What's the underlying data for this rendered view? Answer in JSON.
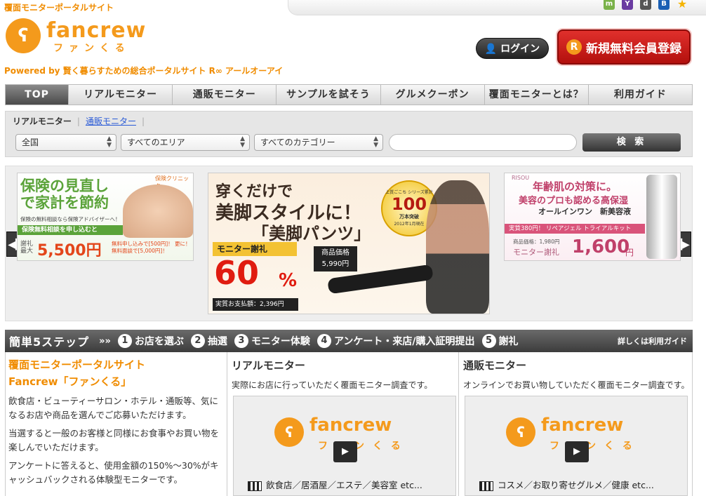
{
  "header": {
    "tagline": "覆面モニターポータルサイト",
    "logo_text": "fancrew",
    "logo_kana": "ファンくる",
    "powered_by": "Powered by 賢く暮らすための総合ポータルサイト R∞ アールオーアイ",
    "login_label": "ログイン",
    "register_label": "新規無料会員登録",
    "social_icons": [
      "mixi-icon",
      "hatena-icon",
      "yahoo-icon",
      "delicious-icon",
      "bookmark-icon",
      "star-icon"
    ]
  },
  "nav": {
    "items": [
      "TOP",
      "リアルモニター",
      "通販モニター",
      "サンプルを試そう",
      "グルメクーポン",
      "覆面モニターとは？",
      "利用ガイド"
    ]
  },
  "search": {
    "tab_active": "リアルモニター",
    "tab_link": "通販モニター",
    "select_region": "全国",
    "select_area": "すべてのエリア",
    "select_category": "すべてのカテゴリー",
    "input_value": "",
    "button_label": "検 索"
  },
  "banners": {
    "left": {
      "headline": "保険の見直しで家計を節約",
      "line1": "保険の無料相談なら保険アドバイザーへ！",
      "line2": "保険無料相談を申し込むと",
      "reward_prefix": "謝礼最大",
      "reward": "5,500円",
      "note": "無料申し込みで[500円]！ 更に！無料面談で[5,000円]！",
      "brand": "保険クリニック"
    },
    "center": {
      "headline1": "穿くだけで",
      "headline2": "美脚スタイルに！",
      "headline3": "「美脚パンツ」",
      "badge_top": "上質ごこち シリーズ累計",
      "badge_num": "100",
      "badge_unit": "万本突破",
      "badge_date": "2012年1月現在",
      "reward_label": "モニター謝礼",
      "reward_pct": "60",
      "reward_sign": "%",
      "price_label": "商品価格",
      "price": "5,990円",
      "actual_label": "実質お支払額：2,396円"
    },
    "right": {
      "brand": "RISOU",
      "headline1": "年齢肌の対策に。",
      "headline2": "美容のプロも認める高保湿",
      "headline3": "オールインワン　新美容液",
      "strip": "実質380円！ リペアジェル トライアルキット",
      "price_label": "商品価格：1,980円",
      "reward_label": "モニター謝礼",
      "reward": "1,600",
      "reward_unit": "円"
    }
  },
  "steps": {
    "title": "簡単5ステップ",
    "items": [
      {
        "num": "1",
        "label": "お店を選ぶ"
      },
      {
        "num": "2",
        "label": "抽選"
      },
      {
        "num": "3",
        "label": "モニター体験"
      },
      {
        "num": "4",
        "label": "アンケート・来店/購入証明提出"
      },
      {
        "num": "5",
        "label": "謝礼"
      }
    ],
    "guide": "詳しくは利用ガイド"
  },
  "intro": {
    "title1": "覆面モニターポータルサイト",
    "title2": "Fancrew「ファンくる」",
    "p1": "飲食店・ビューティーサロン・ホテル・通販等、気になるお店や商品を選んでご応募いただけます。",
    "p2": "当選すると一般のお客様と同様にお食事やお買い物を楽しんでいただけます。",
    "p3": "アンケートに答えると、使用金額の150%〜30%がキャッシュバックされる体験型モニターです。"
  },
  "real_monitor": {
    "title": "リアルモニター",
    "desc": "実際にお店に行っていただく覆面モニター調査です。",
    "caption": "飲食店／居酒屋／エステ／美容室 etc..."
  },
  "mail_monitor": {
    "title": "通販モニター",
    "desc": "オンラインでお買い物していただく覆面モニター調査です。",
    "caption": "コスメ／お取り寄せグルメ／健康 etc..."
  }
}
